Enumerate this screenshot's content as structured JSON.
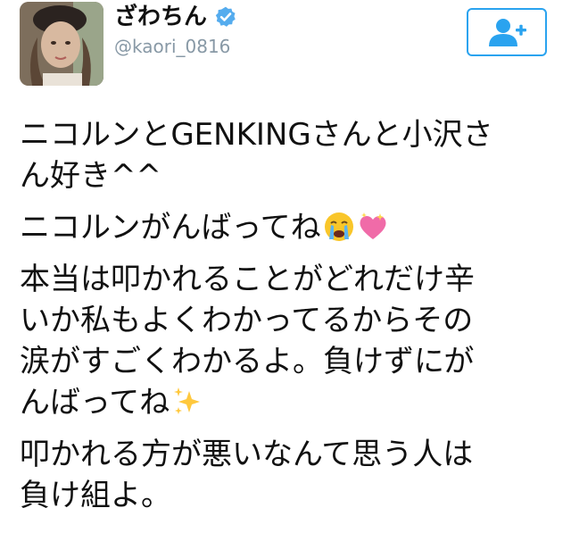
{
  "user": {
    "display_name": "ざわちん",
    "handle": "@kaori_0816",
    "verified": true,
    "avatar_icon": "profile-photo"
  },
  "follow_button": {
    "icon": "add-user-icon",
    "color": "#2aa3ef"
  },
  "tweet": {
    "paragraphs": [
      {
        "lines": [
          "ニコルンとGENKINGさんと小沢さ",
          "ん好き^^"
        ]
      },
      {
        "lines": [
          "ニコルンがんばってね"
        ],
        "emojis": [
          "crying-face-emoji",
          "sparkling-heart-emoji"
        ]
      },
      {
        "lines": [
          "本当は叩かれることがどれだけ辛",
          "いか私もよくわかってるからその",
          "涙がすごくわかるよ。負けずにが",
          "んばってね"
        ],
        "emojis": [
          "sparkles-emoji"
        ]
      },
      {
        "lines": [
          "叩かれる方が悪いなんて思う人は",
          "負け組よ。"
        ]
      }
    ]
  }
}
